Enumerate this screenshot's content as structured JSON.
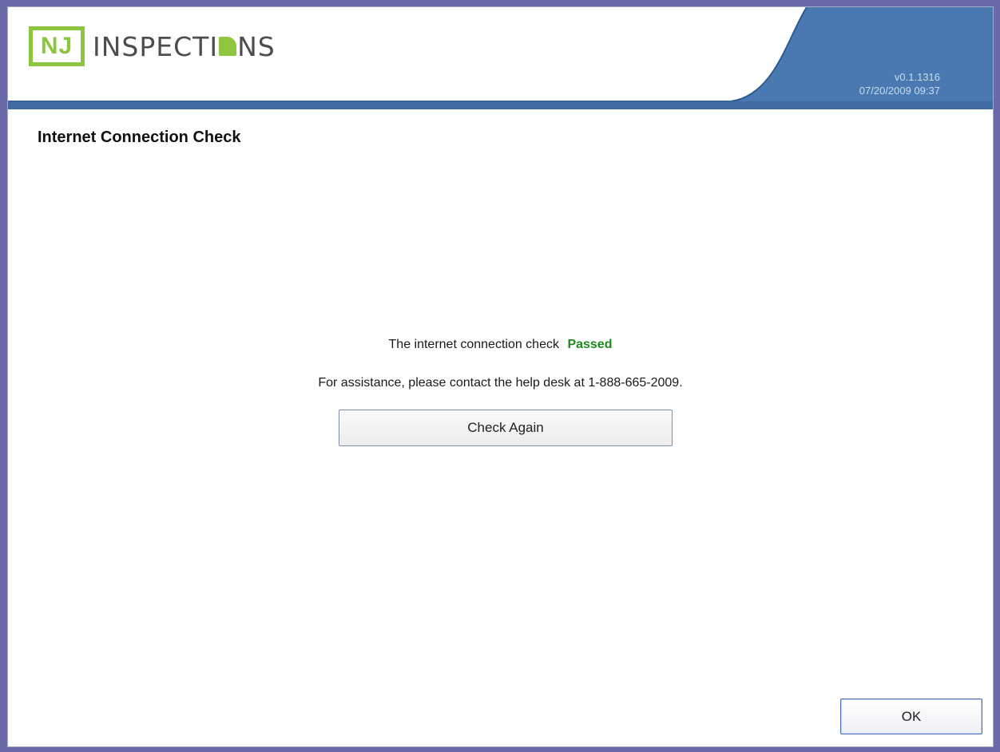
{
  "app": {
    "logo_nj": "NJ",
    "logo_prefix": "INSPECTI",
    "logo_suffix": "NS",
    "version": "v0.1.1316",
    "datetime": "07/20/2009 09:37"
  },
  "page": {
    "title": "Internet Connection Check",
    "status_text": "The internet connection check",
    "status_result": "Passed",
    "help_text": "For assistance, please contact the help desk at 1-888-665-2009.",
    "check_again_label": "Check Again",
    "ok_label": "OK"
  },
  "colors": {
    "window_frame": "#6a6aa8",
    "banner_blue": "#4a78b0",
    "logo_green": "#8cc63f",
    "passed_green": "#1c8a1c"
  }
}
